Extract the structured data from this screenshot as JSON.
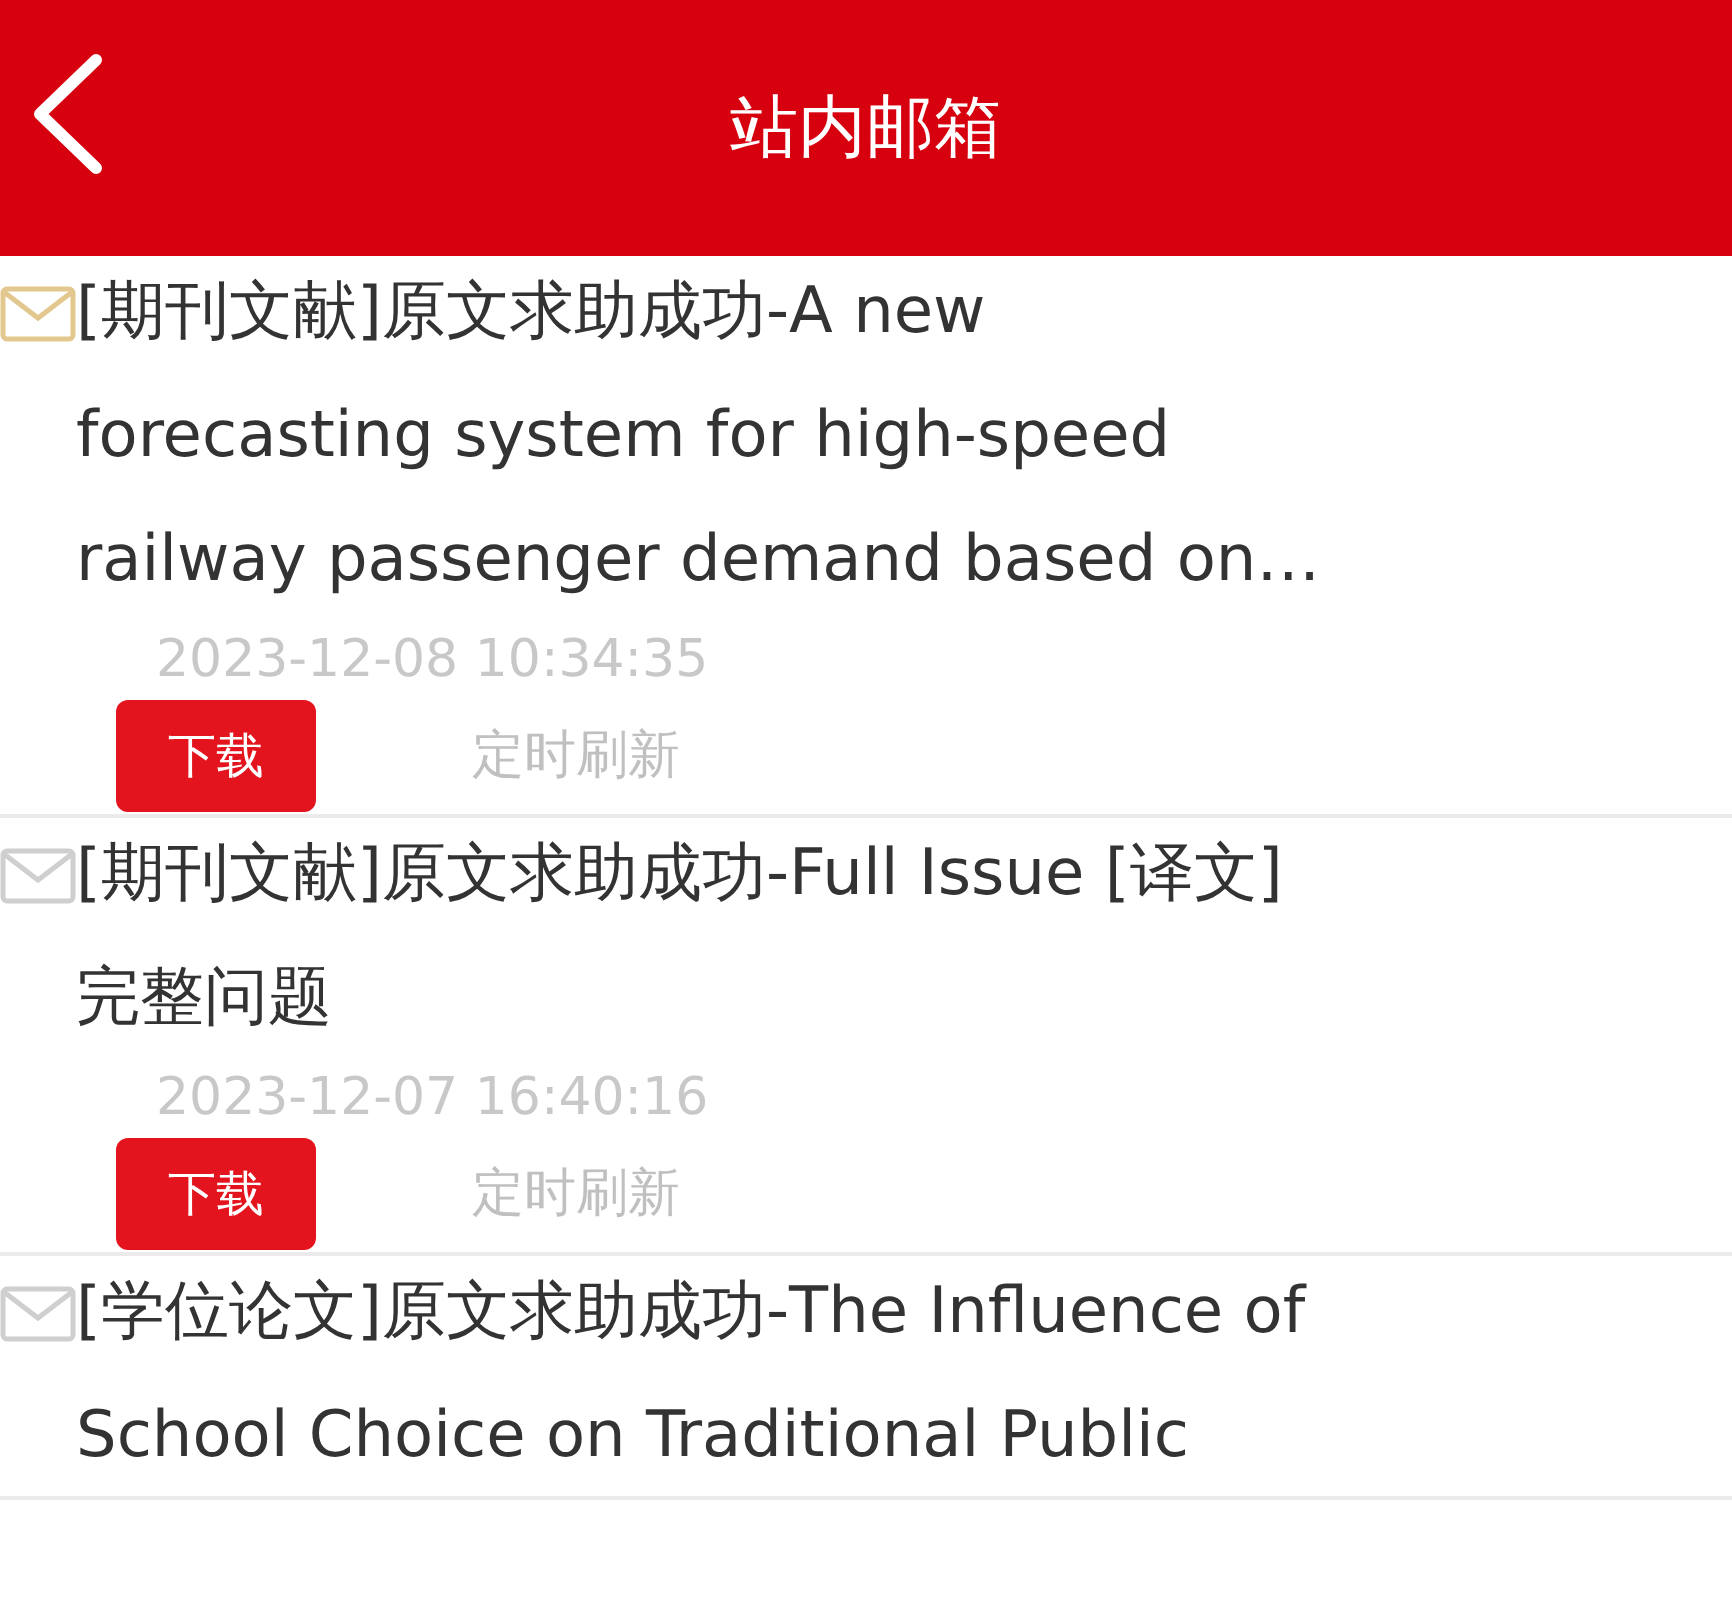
{
  "header": {
    "title": "站内邮箱"
  },
  "messages": [
    {
      "unread": true,
      "title": "[期刊文献]原文求助成功-A new forecasting system for high-speed railway passenger demand based on…",
      "time": "2023-12-08 10:34:35",
      "button": "下载",
      "refresh": "定时刷新"
    },
    {
      "unread": false,
      "title": "[期刊文献]原文求助成功-Full Issue [译文]完整问题",
      "time": "2023-12-07 16:40:16",
      "button": "下载",
      "refresh": "定时刷新"
    },
    {
      "unread": false,
      "title": "[学位论文]原文求助成功-The Influence of School Choice on Traditional Public"
    }
  ]
}
